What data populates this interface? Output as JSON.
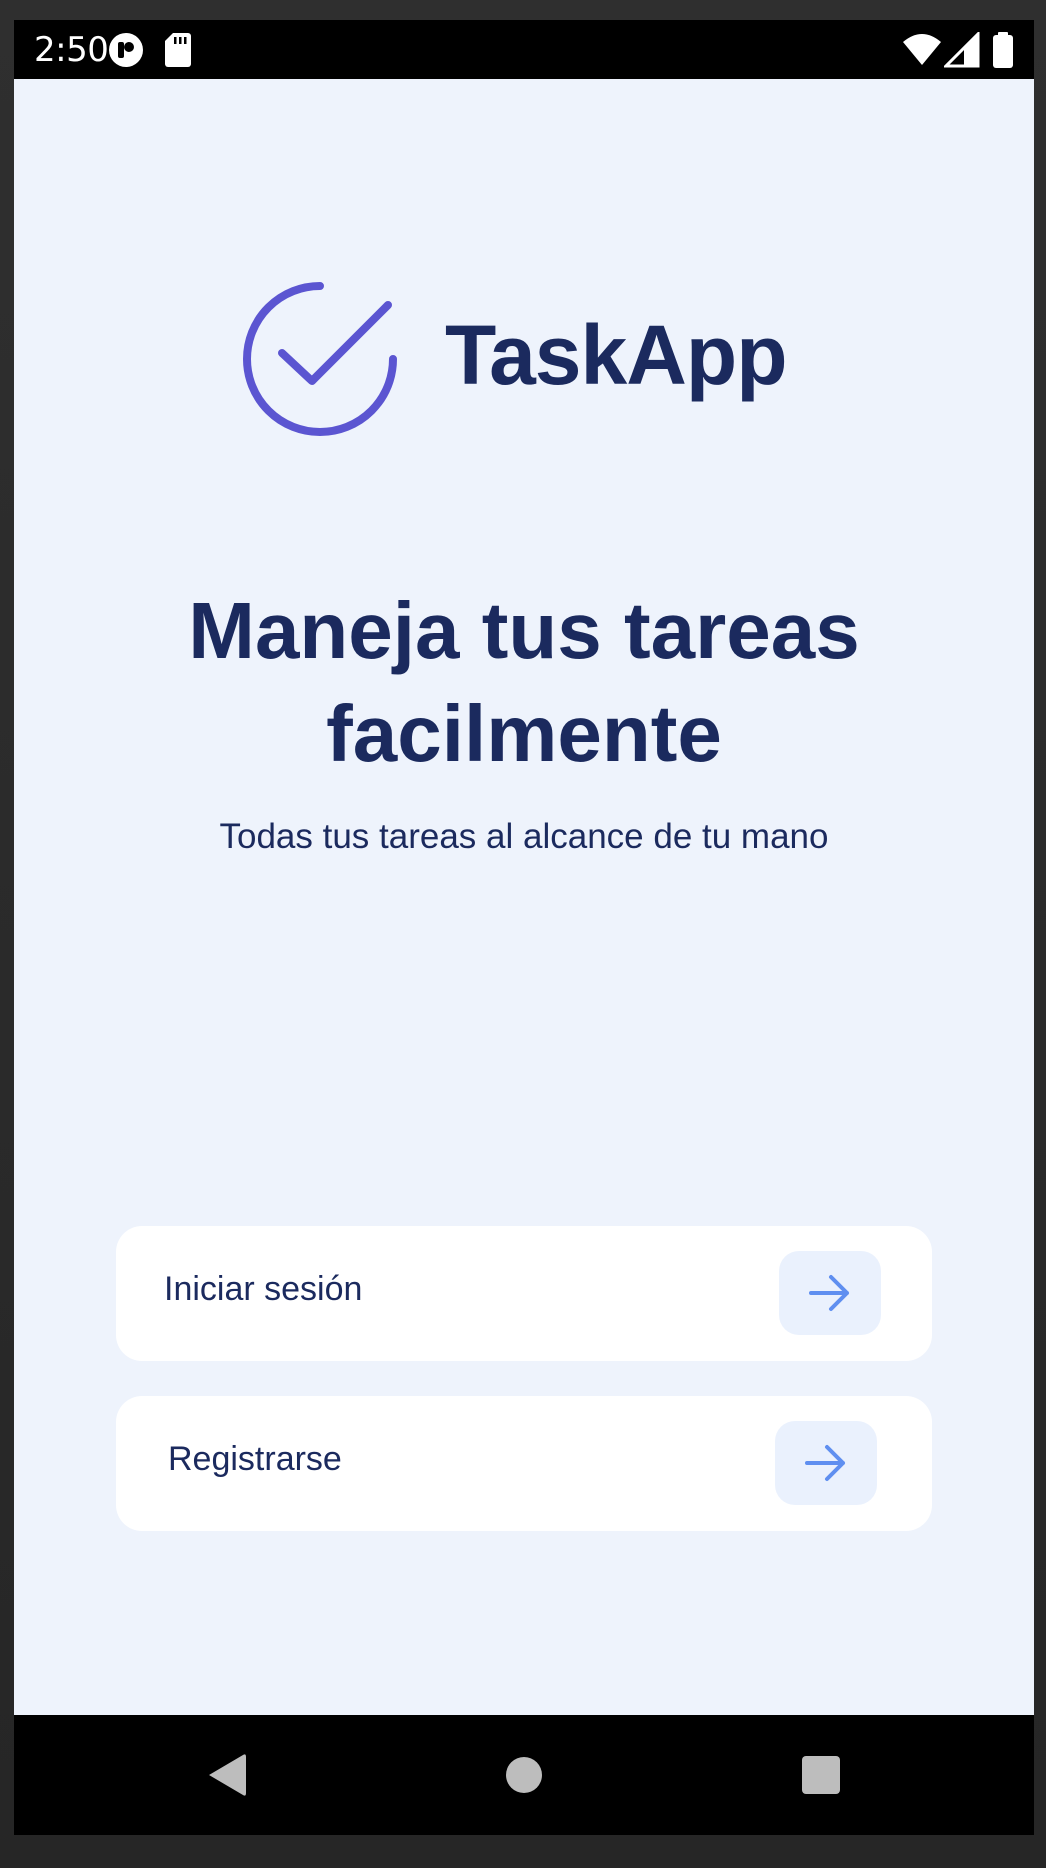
{
  "status_bar": {
    "time": "2:50",
    "icons": [
      "notification-app-icon",
      "sd-card-icon",
      "wifi-icon",
      "cell-signal-icon",
      "battery-icon"
    ]
  },
  "app": {
    "name": "TaskApp",
    "logo_icon": "check-circle-icon",
    "headline": "Maneja tus tareas facilmente",
    "subtitle": "Todas tus tareas al alcance de tu mano",
    "actions": [
      {
        "label": "Iniciar sesión",
        "icon": "arrow-right-icon"
      },
      {
        "label": "Registrarse",
        "icon": "arrow-right-icon"
      }
    ]
  },
  "nav_bar": {
    "buttons": [
      "back-icon",
      "home-icon",
      "recents-icon"
    ]
  },
  "colors": {
    "background": "#eef3fc",
    "primary_text": "#1b2a5e",
    "logo": "#5b55d1",
    "arrow": "#5f8ff0",
    "card": "#ffffff",
    "arrow_button_bg": "#eaf1fd"
  }
}
